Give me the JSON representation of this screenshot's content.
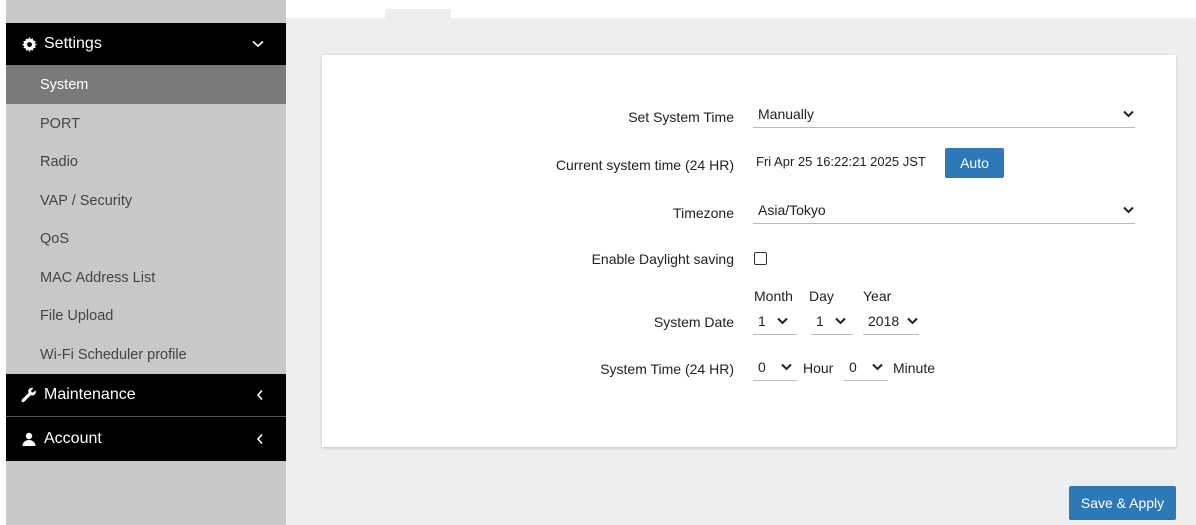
{
  "sidebar": {
    "settings_label": "Settings",
    "items": [
      {
        "label": "System",
        "active": true
      },
      {
        "label": "PORT"
      },
      {
        "label": "Radio"
      },
      {
        "label": "VAP / Security"
      },
      {
        "label": "QoS"
      },
      {
        "label": "MAC Address List"
      },
      {
        "label": "File Upload"
      },
      {
        "label": "Wi-Fi Scheduler profile"
      }
    ],
    "maintenance_label": "Maintenance",
    "account_label": "Account"
  },
  "form": {
    "set_system_time": {
      "label": "Set System Time",
      "value": "Manually"
    },
    "current_time": {
      "label": "Current system time (24 HR)",
      "value": "Fri Apr 25 16:22:21 2025 JST",
      "button": "Auto"
    },
    "timezone": {
      "label": "Timezone",
      "value": "Asia/Tokyo"
    },
    "daylight": {
      "label": "Enable Daylight saving",
      "checked": false
    },
    "system_date": {
      "label": "System Date",
      "month_label": "Month",
      "day_label": "Day",
      "year_label": "Year",
      "month": "1",
      "day": "1",
      "year": "2018"
    },
    "system_time": {
      "label": "System Time (24 HR)",
      "hour": "0",
      "hour_label": "Hour",
      "minute": "0",
      "minute_label": "Minute"
    }
  },
  "save_button": "Save & Apply",
  "colors": {
    "accent": "#2d79b7",
    "sidebar_bg": "#c8c8c8",
    "sidebar_active": "#7a7a7a",
    "header_bg": "#000000"
  }
}
